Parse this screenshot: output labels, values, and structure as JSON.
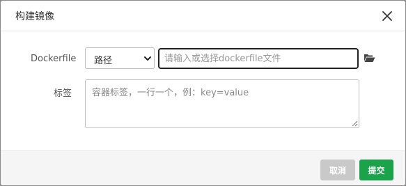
{
  "dialog": {
    "title": "构建镜像",
    "close_icon": "close-icon"
  },
  "form": {
    "dockerfile_label": "Dockerfile",
    "source_select_value": "路径",
    "file_placeholder": "请输入或选择dockerfile文件",
    "file_value": "",
    "folder_icon": "folder-open-icon",
    "tags_label": "标签",
    "tags_placeholder": "容器标签，一行一个，例：key=value",
    "tags_value": ""
  },
  "footer": {
    "cancel_label": "取消",
    "submit_label": "提交"
  },
  "colors": {
    "submit": "#1aa34a",
    "cancel": "#c9c9c9"
  }
}
